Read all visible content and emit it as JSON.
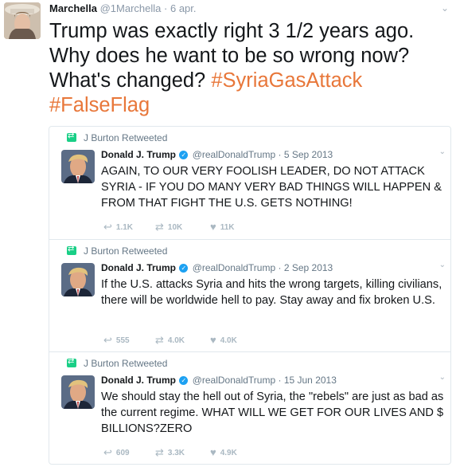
{
  "tweet": {
    "author_name": "Marchella",
    "author_handle": "@1Marchella",
    "separator": "·",
    "date": "6 apr.",
    "text": "Trump was exactly right 3 1/2 years ago. Why does he want to be so wrong now? What's changed?",
    "hashtags": [
      "#SyriaGasAttack",
      "#FalseFlag"
    ]
  },
  "quoted": [
    {
      "retweeted_by": "J Burton Retweeted",
      "name": "Donald J. Trump",
      "handle": "@realDonaldTrump",
      "date": "· 5 Sep 2013",
      "text": "AGAIN, TO OUR VERY FOOLISH LEADER, DO NOT ATTACK SYRIA - IF YOU DO MANY VERY BAD THINGS WILL HAPPEN & FROM THAT FIGHT THE U.S. GETS NOTHING!",
      "replies": "1.1K",
      "retweets": "10K",
      "likes": "11K"
    },
    {
      "retweeted_by": "J Burton Retweeted",
      "name": "Donald J. Trump",
      "handle": "@realDonaldTrump",
      "date": "· 2 Sep 2013",
      "text": "If the U.S. attacks Syria and hits the wrong targets, killing civilians, there will be worldwide hell to pay. Stay away and fix broken U.S.",
      "replies": "555",
      "retweets": "4.0K",
      "likes": "4.0K"
    },
    {
      "retweeted_by": "J Burton Retweeted",
      "name": "Donald J. Trump",
      "handle": "@realDonaldTrump",
      "date": "· 15 Jun 2013",
      "text": "We should stay the hell out of Syria, the \"rebels\" are just as bad as the current regime. WHAT WILL WE GET FOR OUR LIVES AND $ BILLIONS?ZERO",
      "replies": "609",
      "retweets": "3.3K",
      "likes": "4.9K"
    }
  ],
  "icons": {
    "reply": "reply-icon",
    "retweet": "retweet-icon",
    "like": "heart-icon",
    "more": "chevron-down-icon",
    "verified": "verified-badge-icon"
  },
  "colors": {
    "hashtag": "#e8773a",
    "retweet_badge": "#19cf86",
    "verified": "#1da1f2",
    "action_grey": "#aab8c2"
  }
}
